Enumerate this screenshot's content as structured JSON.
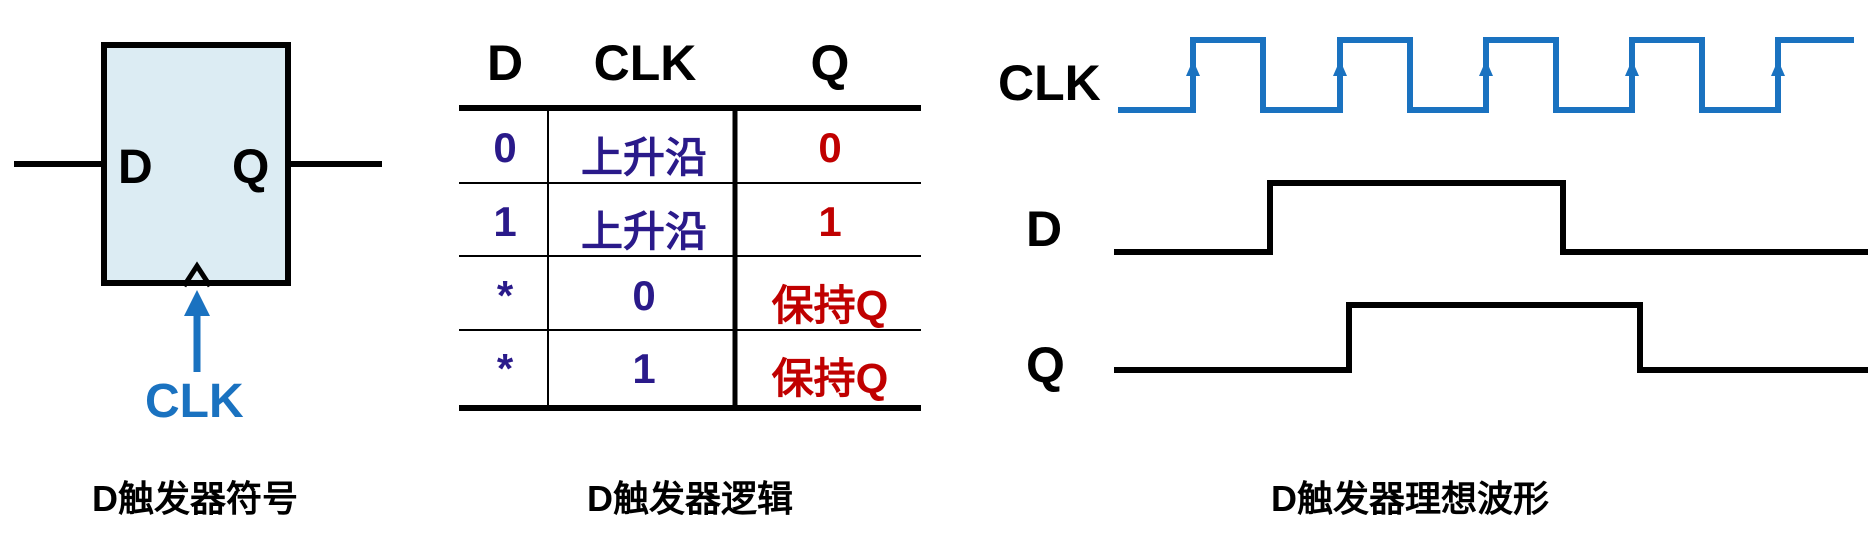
{
  "symbol": {
    "input_label": "D",
    "output_label": "Q",
    "clock_label": "CLK",
    "caption": "D触发器符号"
  },
  "truth_table": {
    "headers": [
      "D",
      "CLK",
      "Q"
    ],
    "rows": [
      [
        "0",
        "上升沿",
        "0"
      ],
      [
        "1",
        "上升沿",
        "1"
      ],
      [
        "*",
        "0",
        "保持Q"
      ],
      [
        "*",
        "1",
        "保持Q"
      ]
    ],
    "caption": "D触发器逻辑"
  },
  "waveform": {
    "signals": [
      "CLK",
      "D",
      "Q"
    ],
    "caption": "D触发器理想波形"
  },
  "colors": {
    "clock_blue": "#1a72c0",
    "table_blue": "#2a1a8a",
    "table_red": "#c00000",
    "symbol_fill": "#dcecf3"
  }
}
